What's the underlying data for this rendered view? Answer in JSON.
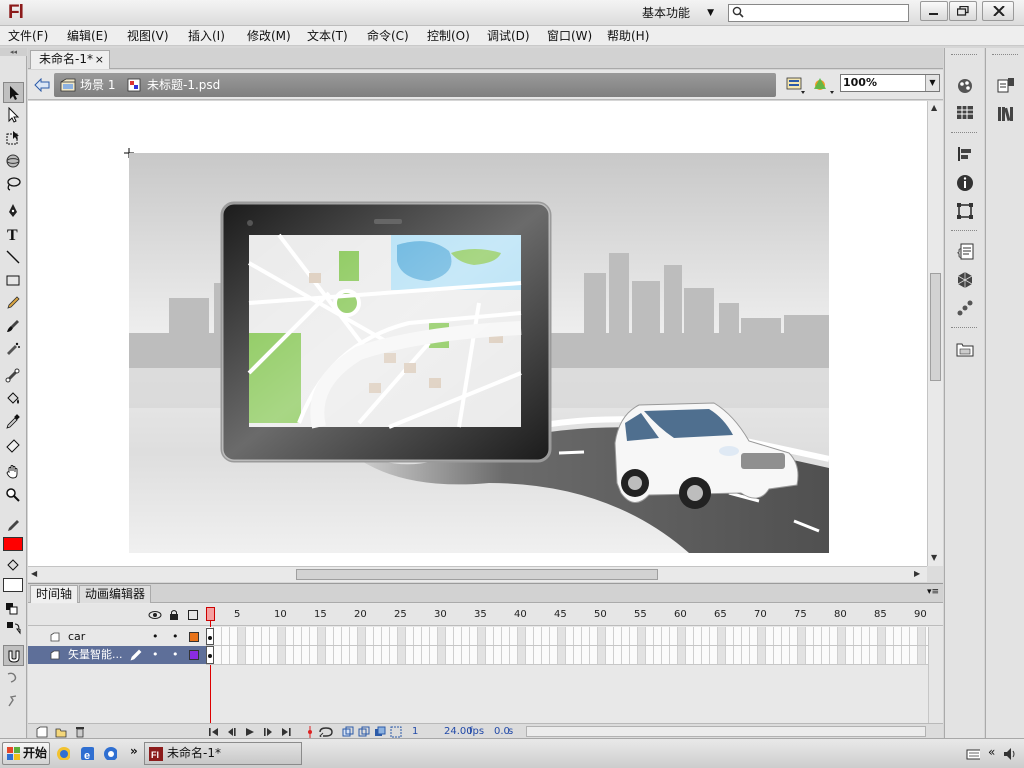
{
  "app": {
    "logo_text": "Fl",
    "workspace_label": "基本功能",
    "search_placeholder": ""
  },
  "menu": [
    {
      "label": "文件(F)"
    },
    {
      "label": "编辑(E)"
    },
    {
      "label": "视图(V)"
    },
    {
      "label": "插入(I)"
    },
    {
      "label": "修改(M)"
    },
    {
      "label": "文本(T)"
    },
    {
      "label": "命令(C)"
    },
    {
      "label": "控制(O)"
    },
    {
      "label": "调试(D)"
    },
    {
      "label": "窗口(W)"
    },
    {
      "label": "帮助(H)"
    }
  ],
  "document": {
    "tab_title": "未命名-1*",
    "tab_close": "×"
  },
  "editbar": {
    "scene_label": "场景 1",
    "symbol_label": "未标题-1.psd",
    "zoom_value": "100%"
  },
  "timeline": {
    "tabs": [
      {
        "label": "时间轴",
        "active": true
      },
      {
        "label": "动画编辑器",
        "active": false
      }
    ],
    "frame_numbers": [
      "1",
      "5",
      "10",
      "15",
      "20",
      "25",
      "30",
      "35",
      "40",
      "45",
      "50",
      "55",
      "60",
      "65",
      "70",
      "75",
      "80",
      "85",
      "90"
    ],
    "layers": [
      {
        "name": "car",
        "selected": false,
        "color": "#e8731a"
      },
      {
        "name": "矢量智能...",
        "selected": true,
        "color": "#8a2be2"
      }
    ],
    "current_frame": "1",
    "fps": "24.00",
    "fps_unit": "fps",
    "elapsed_time": "0.0",
    "time_unit": "s"
  },
  "taskbar": {
    "start_label": "开始",
    "window_button_label": "未命名-1*",
    "more_glyph": "»"
  },
  "colors": {
    "stroke_color": "#000000",
    "fill_color": "#ff0000",
    "layer_highlight": "#5e6f99"
  },
  "icons": {
    "tools": [
      "selection-arrow-icon",
      "subselection-icon",
      "free-transform-icon",
      "3d-rotation-icon",
      "lasso-icon",
      "pen-icon",
      "text-tool-icon",
      "line-tool-icon",
      "rectangle-tool-icon",
      "pencil-icon",
      "brush-icon",
      "deco-icon",
      "bone-icon",
      "paint-bucket-icon",
      "eyedropper-icon",
      "eraser-icon",
      "hand-icon",
      "zoom-icon"
    ],
    "right_panels": [
      "color-panel-icon",
      "swatches-icon",
      "align-icon",
      "info-icon",
      "transform-icon",
      "actions-icon",
      "components-icon",
      "motion-presets-icon",
      "library-icon",
      "properties-icon",
      "library-books-icon"
    ]
  }
}
